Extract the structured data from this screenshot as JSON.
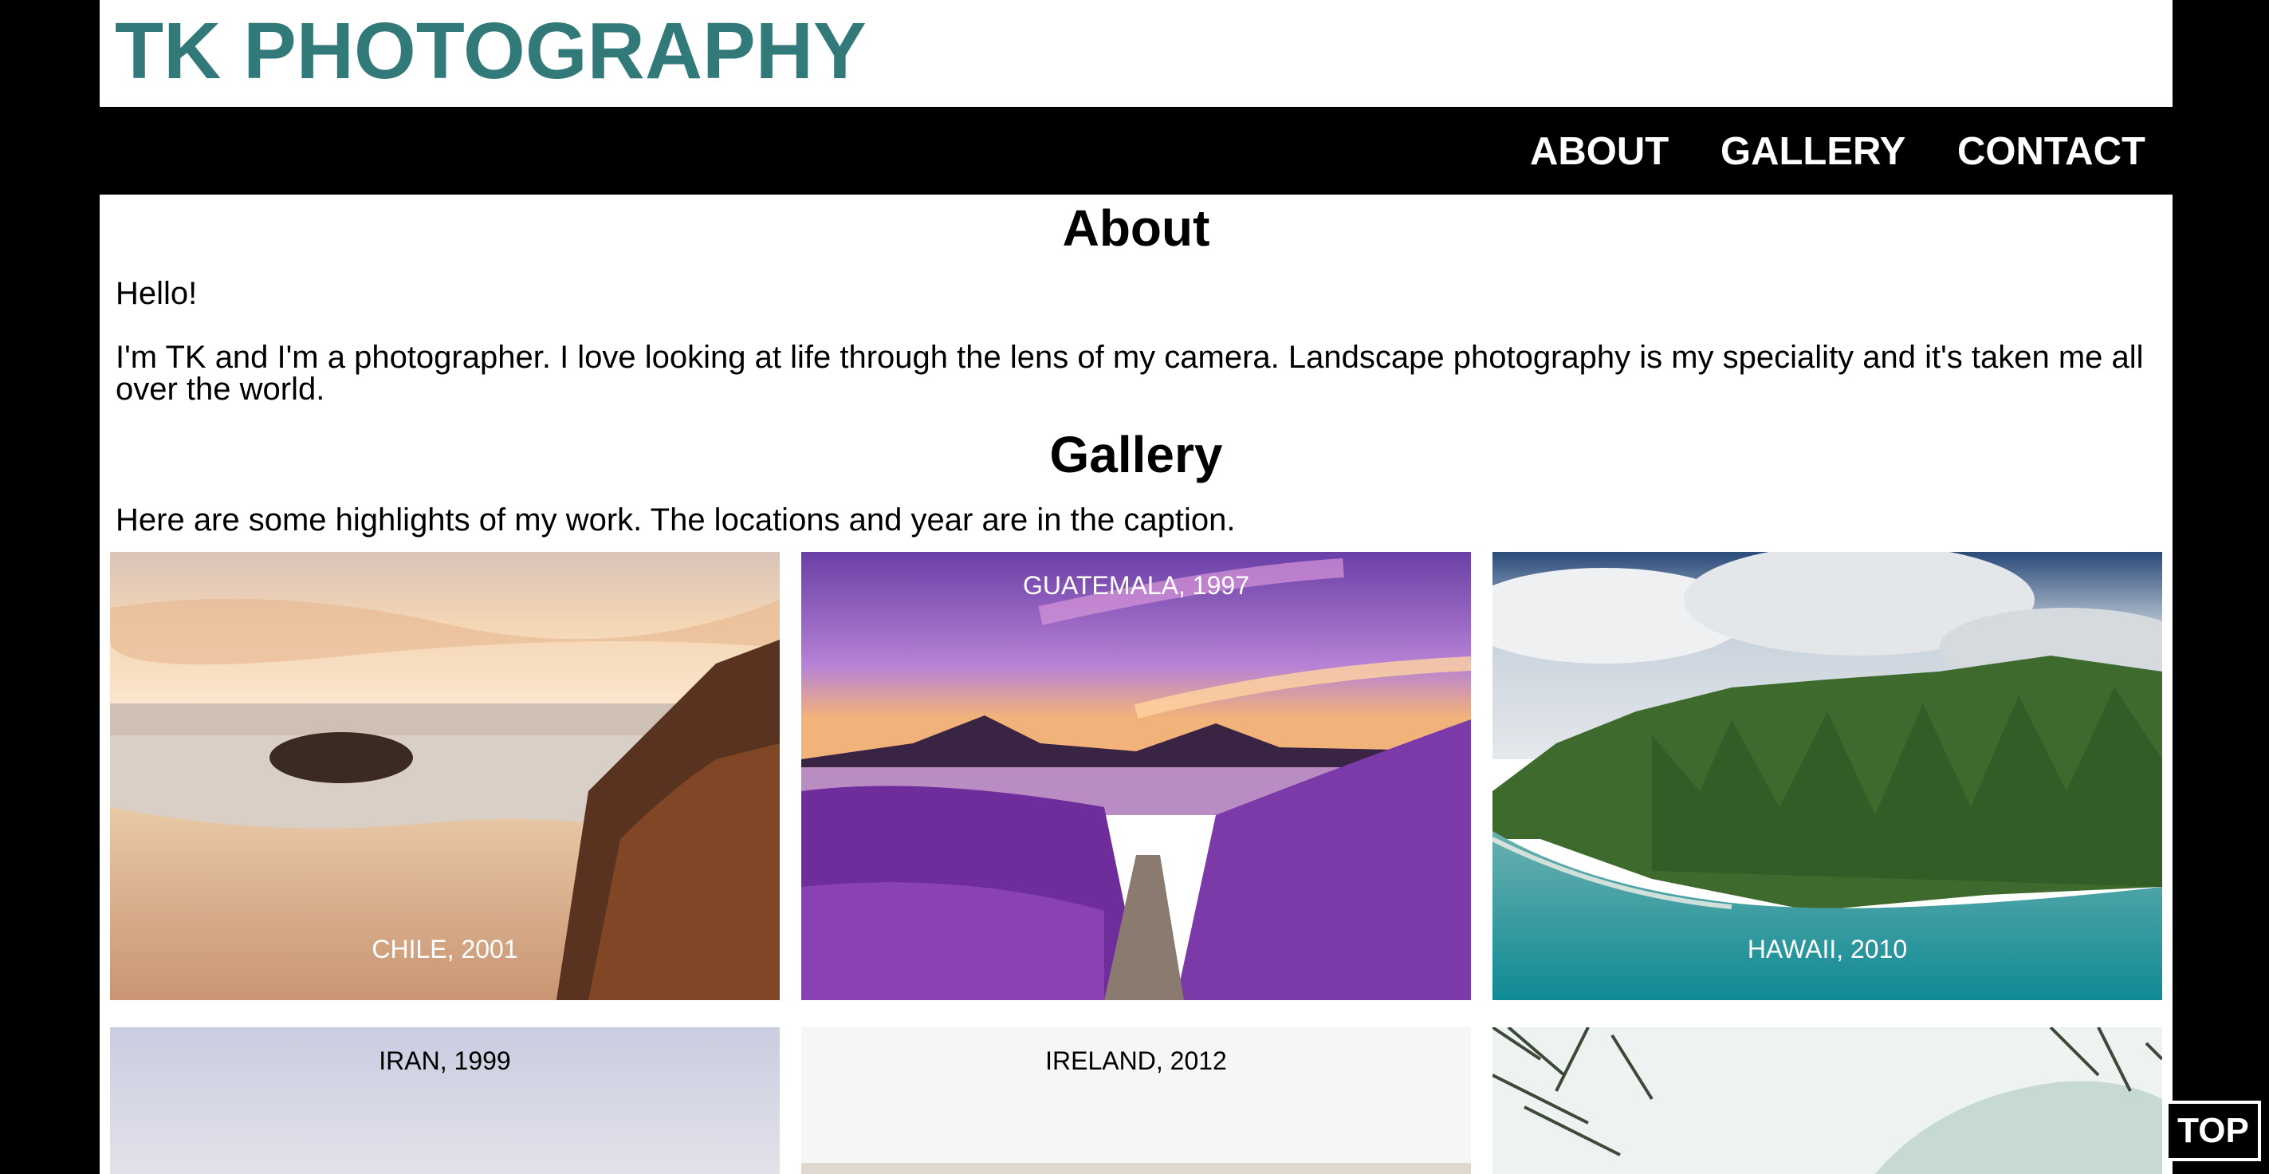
{
  "header": {
    "brand": "TK PHOTOGRAPHY"
  },
  "nav": {
    "items": [
      {
        "label": "ABOUT"
      },
      {
        "label": "GALLERY"
      },
      {
        "label": "CONTACT"
      }
    ]
  },
  "about": {
    "title": "About",
    "greeting": "Hello!",
    "bio": "I'm TK and I'm a photographer. I love looking at life through the lens of my camera. Landscape photography is my speciality and it's taken me all over the world."
  },
  "gallery": {
    "title": "Gallery",
    "intro": "Here are some highlights of my work. The locations and year are in the caption.",
    "photos": [
      {
        "caption": "CHILE, 2001"
      },
      {
        "caption": "GUATEMALA, 1997"
      },
      {
        "caption": "HAWAII, 2010"
      },
      {
        "caption": "IRAN, 1999"
      },
      {
        "caption": "IRELAND, 2012"
      },
      {
        "caption": ""
      }
    ]
  },
  "top_button": {
    "label": "TOP"
  },
  "colors": {
    "brand": "#327a7a",
    "nav_background": "#000000",
    "page_background": "#ffffff",
    "outer_background": "#000000"
  }
}
